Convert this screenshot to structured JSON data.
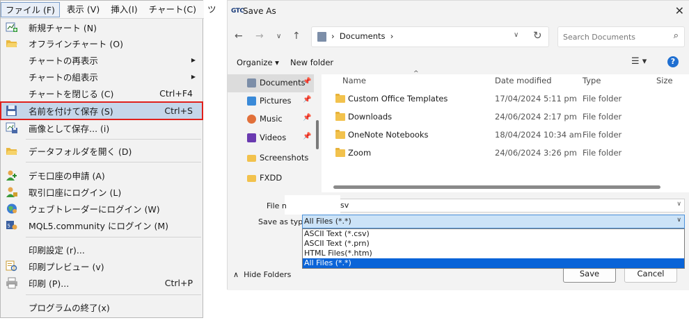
{
  "menubar": {
    "items": [
      "ファイル (F)",
      "表示 (V)",
      "挿入(I)",
      "チャート(C)",
      "ツ"
    ]
  },
  "file_menu": {
    "items": [
      {
        "label": "新規チャート (N)",
        "shortcut": "",
        "icon": "new-chart-icon"
      },
      {
        "label": "オフラインチャート (O)",
        "shortcut": "",
        "icon": "open-folder-icon"
      },
      {
        "label": "チャートの再表示",
        "shortcut": "",
        "icon": ""
      },
      {
        "label": "チャートの組表示",
        "shortcut": "",
        "icon": ""
      },
      {
        "label": "チャートを閉じる (C)",
        "shortcut": "Ctrl+F4",
        "icon": ""
      },
      {
        "label": "名前を付けて保存 (S)",
        "shortcut": "Ctrl+S",
        "icon": "floppy-disk-icon"
      },
      {
        "label": "画像として保存... (i)",
        "shortcut": "",
        "icon": "save-image-icon"
      },
      {
        "label": "データフォルダを開く (D)",
        "shortcut": "",
        "icon": "folder-icon"
      },
      {
        "label": "デモ口座の申請 (A)",
        "shortcut": "",
        "icon": "demo-account-icon"
      },
      {
        "label": "取引口座にログイン (L)",
        "shortcut": "",
        "icon": "trade-login-icon"
      },
      {
        "label": "ウェブトレーダーにログイン (W)",
        "shortcut": "",
        "icon": "globe-icon"
      },
      {
        "label": "MQL5.community にログイン (M)",
        "shortcut": "",
        "icon": "mql5-icon"
      },
      {
        "label": "印刷設定 (r)...",
        "shortcut": "",
        "icon": ""
      },
      {
        "label": "印刷プレビュー (v)",
        "shortcut": "",
        "icon": "print-preview-icon"
      },
      {
        "label": "印刷 (P)...",
        "shortcut": "Ctrl+P",
        "icon": "printer-icon"
      },
      {
        "label": "プログラムの終了(x)",
        "shortcut": "",
        "icon": ""
      }
    ]
  },
  "dialog": {
    "app_logo": "GTC",
    "title": "Save As",
    "address": "Documents",
    "search_placeholder": "Search Documents",
    "organize": "Organize ▾",
    "new_folder": "New folder",
    "nav_items": [
      "Documents",
      "Pictures",
      "Music",
      "Videos",
      "Screenshots",
      "FXDD"
    ],
    "columns": [
      "Name",
      "Date modified",
      "Type",
      "Size"
    ],
    "files": [
      {
        "name": "Custom Office Templates",
        "date": "17/04/2024 5:11 pm",
        "type": "File folder"
      },
      {
        "name": "Downloads",
        "date": "24/06/2024 2:17 pm",
        "type": "File folder"
      },
      {
        "name": "OneNote Notebooks",
        "date": "18/04/2024 10:34 am",
        "type": "File folder"
      },
      {
        "name": "Zoom",
        "date": "24/06/2024 3:26 pm",
        "type": "File folder"
      }
    ],
    "file_name_label": "File n",
    "file_name_value": "sv",
    "save_type_label": "Save as type:",
    "save_type_value": "All Files (*.*)",
    "save_type_options": [
      "ASCII Text (*.csv)",
      "ASCII Text (*.prn)",
      "HTML Files(*.htm)",
      "All Files (*.*)"
    ],
    "hide_folders": "Hide Folders",
    "save": "Save",
    "cancel": "Cancel"
  },
  "colors": {
    "highlight_outline": "#e0201c",
    "menu_highlight": "#c5d6ea",
    "selected_option": "#0a64d8",
    "help_icon": "#1f6fd1"
  }
}
